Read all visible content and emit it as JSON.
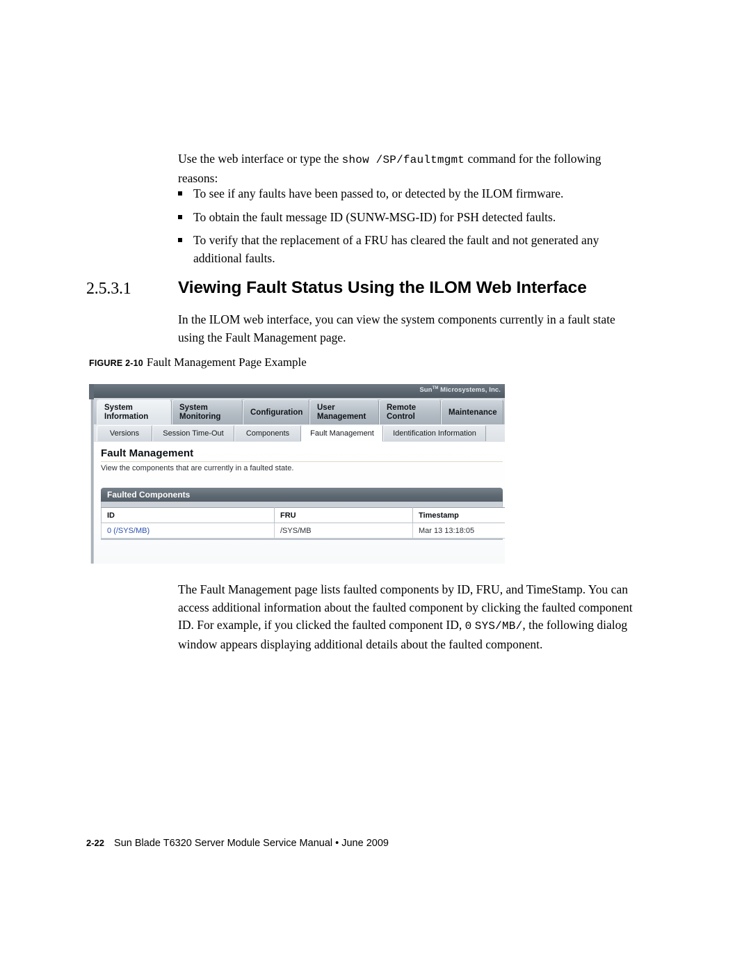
{
  "intro": {
    "lead_a": "Use the web interface or type the ",
    "lead_cmd": "show /SP/faultmgmt",
    "lead_b": " command for the following reasons:",
    "bullets": [
      "To see if any faults have been passed to, or detected by the ILOM firmware.",
      "To obtain the fault message ID (SUNW-MSG-ID) for PSH detected faults.",
      "To verify that the replacement of a FRU has cleared the fault and not generated any additional faults."
    ]
  },
  "section": {
    "number": "2.5.3.1",
    "title": "Viewing Fault Status Using the ILOM Web Interface",
    "paragraph": "In the ILOM web interface, you can view the system components currently in a fault state using the Fault Management page."
  },
  "figure": {
    "label": "FIGURE 2-10",
    "caption": "Fault Management Page Example",
    "brand": "Sun",
    "brand_tm": "TM",
    "brand_rest": " Microsystems, Inc.",
    "primary_tabs": [
      {
        "line1": "System",
        "line2": "Information",
        "active": true
      },
      {
        "line1": "System",
        "line2": "Monitoring",
        "active": false
      },
      {
        "line1": "Configuration",
        "line2": "",
        "active": false
      },
      {
        "line1": "User",
        "line2": "Management",
        "active": false
      },
      {
        "line1": "Remote",
        "line2": "Control",
        "active": false
      },
      {
        "line1": "Maintenance",
        "line2": "",
        "active": false
      }
    ],
    "secondary_tabs": [
      {
        "label": "Versions",
        "active": false
      },
      {
        "label": "Session Time-Out",
        "active": false
      },
      {
        "label": "Components",
        "active": false
      },
      {
        "label": "Fault Management",
        "active": true
      },
      {
        "label": "Identification Information",
        "active": false
      }
    ],
    "page_title": "Fault Management",
    "page_description": "View the components that are currently in a faulted state.",
    "panel_title": "Faulted Components",
    "table": {
      "columns": [
        "ID",
        "FRU",
        "Timestamp"
      ],
      "rows": [
        {
          "id": "0 (/SYS/MB)",
          "fru": "/SYS/MB",
          "timestamp": "Mar 13 13:18:05"
        }
      ]
    },
    "link_color": "#2b4fb0"
  },
  "after_figure": {
    "line1": "The Fault Management page lists faulted components by ID, FRU, and TimeStamp.",
    "line2": "You can access additional information about the faulted component by clicking the",
    "line3a": "faulted component ID. For example, if you clicked the faulted component ID, ",
    "line3_code": "0",
    "line4_code": "SYS/MB/",
    "line4b": ", the following dialog window appears displaying additional details about",
    "line5": "the faulted component."
  },
  "footer": {
    "page_number": "2-22",
    "text": "Sun Blade T6320 Server Module Service Manual • June 2009"
  }
}
